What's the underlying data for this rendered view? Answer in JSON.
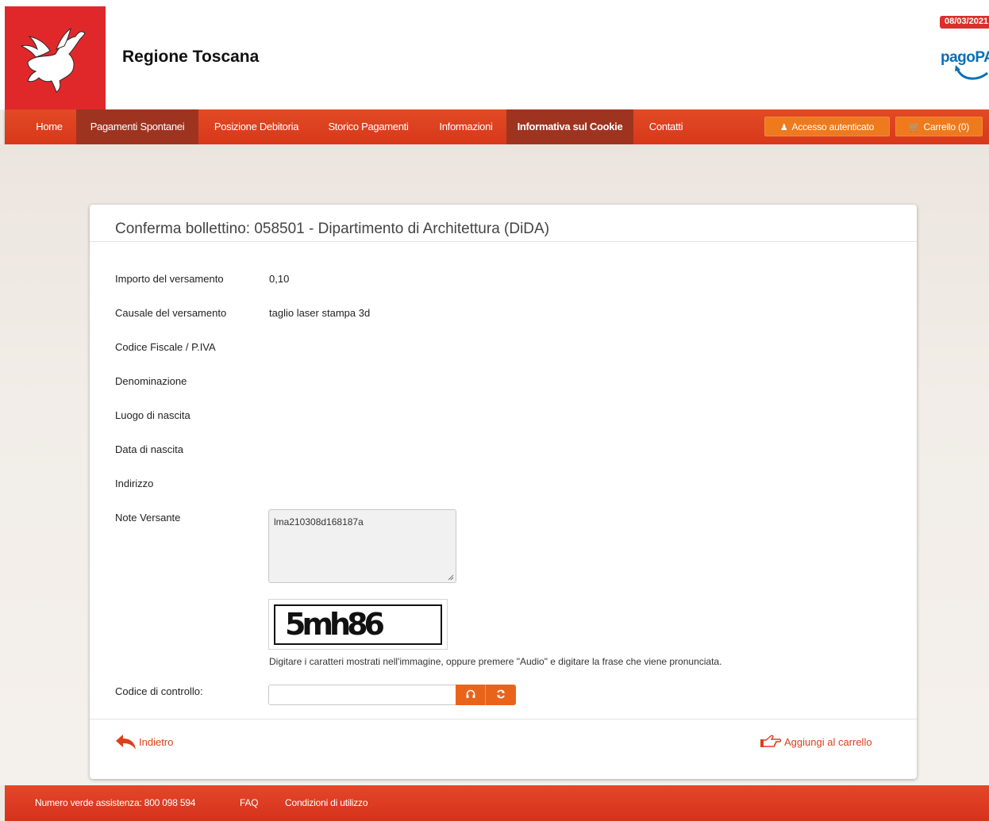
{
  "header": {
    "site_title": "Regione Toscana",
    "date_badge": "08/03/2021",
    "pagopa_logo": "pagoPA",
    "brand_color": "#e0282b"
  },
  "nav": {
    "items": [
      {
        "label": "Home"
      },
      {
        "label": "Pagamenti Spontanei"
      },
      {
        "label": "Posizione Debitoria"
      },
      {
        "label": "Storico Pagamenti"
      },
      {
        "label": "Informazioni"
      },
      {
        "label": "Informativa sul Cookie"
      },
      {
        "label": "Contatti"
      }
    ],
    "login_label": "Accesso autenticato",
    "login_icon": "user-icon",
    "cart_label": "Carrello (0)",
    "cart_icon": "cart-icon"
  },
  "form": {
    "title": "Conferma bollettino: 058501 - Dipartimento di Architettura (DiDA)",
    "rows": [
      {
        "label": "Importo del versamento",
        "value": "0,10"
      },
      {
        "label": "Causale del versamento",
        "value": "taglio laser stampa 3d"
      },
      {
        "label": "Codice Fiscale / P.IVA",
        "value": ""
      },
      {
        "label": "Denominazione",
        "value": ""
      },
      {
        "label": "Luogo di nascita",
        "value": ""
      },
      {
        "label": "Data di nascita",
        "value": ""
      },
      {
        "label": "Indirizzo",
        "value": ""
      },
      {
        "label": "Note Versante",
        "value": ""
      }
    ],
    "note_value": "lma210308d168187a",
    "captcha_text": "5mh86",
    "captcha_hint": "Digitare i caratteri mostrati nell'immagine, oppure premere \"Audio\" e digitare la frase che viene pronunciata.",
    "control_label": "Codice di controllo:",
    "control_value": "",
    "audio_icon": "headphones-icon",
    "refresh_icon": "refresh-icon",
    "back_label": "Indietro",
    "add_label": "Aggiungi al carrello"
  },
  "footer": {
    "helpline": "Numero verde assistenza: 800 098 594",
    "faq": "FAQ",
    "terms": "Condizioni di utilizzo"
  }
}
